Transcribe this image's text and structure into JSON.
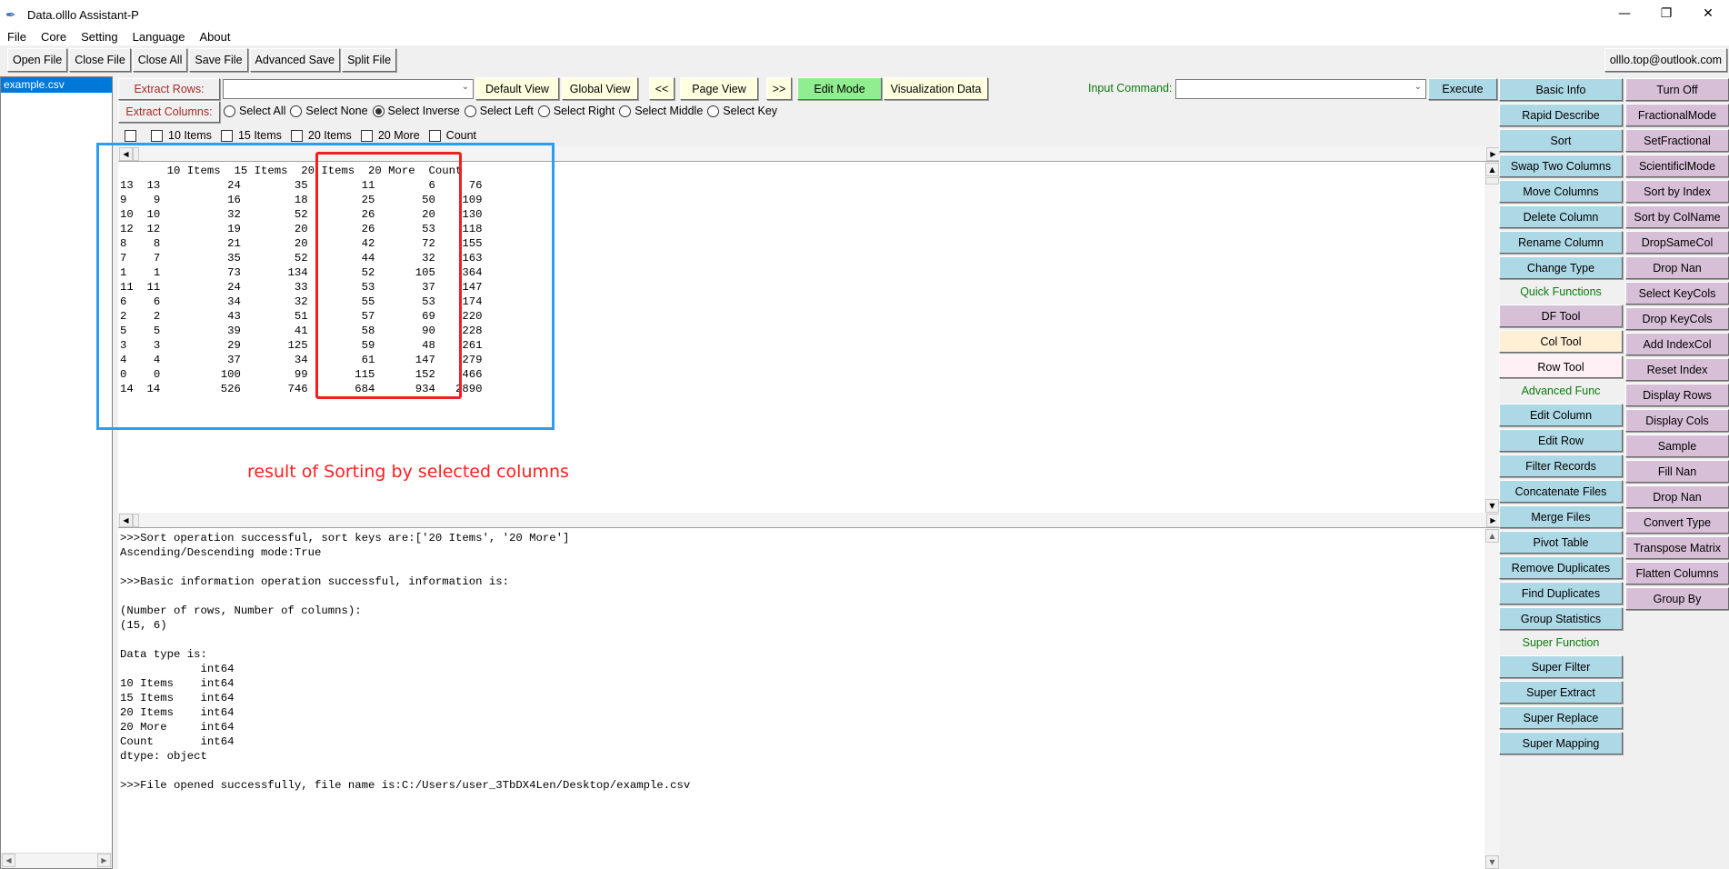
{
  "window": {
    "title": "Data.olllo Assistant-P",
    "controls": [
      "minimize-icon",
      "restore-icon",
      "close-icon"
    ]
  },
  "menu": [
    "File",
    "Core",
    "Setting",
    "Language",
    "About"
  ],
  "toolbar": [
    "Open File",
    "Close File",
    "Close All",
    "Save File",
    "Advanced Save",
    "Split File"
  ],
  "email": "olllo.top@outlook.com",
  "files": [
    "example.csv"
  ],
  "extract_rows_label": "Extract Rows:",
  "extract_rows_value": "",
  "extract_columns_label": "Extract Columns:",
  "view_buttons": [
    "Default View",
    "Global View",
    "<<",
    "Page View",
    ">>",
    "Edit Mode",
    "Visualization Data"
  ],
  "radio_options": [
    {
      "label": "Select All",
      "checked": false
    },
    {
      "label": "Select None",
      "checked": false
    },
    {
      "label": "Select Inverse",
      "checked": true
    },
    {
      "label": "Select Left",
      "checked": false
    },
    {
      "label": "Select Right",
      "checked": false
    },
    {
      "label": "Select Middle",
      "checked": false
    },
    {
      "label": "Select Key",
      "checked": false
    }
  ],
  "column_checks": [
    "",
    "10 Items",
    "15 Items",
    "20 Items",
    "20 More",
    "Count"
  ],
  "input_command": {
    "label": "Input Command:",
    "value": "",
    "execute": "Execute"
  },
  "table": {
    "columns": [
      "",
      "10 Items",
      "15 Items",
      "20 Items",
      "20 More",
      "Count"
    ],
    "rows": [
      [
        "13",
        "13",
        "24",
        "35",
        "11",
        "6",
        "76"
      ],
      [
        "9",
        "9",
        "16",
        "18",
        "25",
        "50",
        "109"
      ],
      [
        "10",
        "10",
        "32",
        "52",
        "26",
        "20",
        "130"
      ],
      [
        "12",
        "12",
        "19",
        "20",
        "26",
        "53",
        "118"
      ],
      [
        "8",
        "8",
        "21",
        "20",
        "42",
        "72",
        "155"
      ],
      [
        "7",
        "7",
        "35",
        "52",
        "44",
        "32",
        "163"
      ],
      [
        "1",
        "1",
        "73",
        "134",
        "52",
        "105",
        "364"
      ],
      [
        "11",
        "11",
        "24",
        "33",
        "53",
        "37",
        "147"
      ],
      [
        "6",
        "6",
        "34",
        "32",
        "55",
        "53",
        "174"
      ],
      [
        "2",
        "2",
        "43",
        "51",
        "57",
        "69",
        "220"
      ],
      [
        "5",
        "5",
        "39",
        "41",
        "58",
        "90",
        "228"
      ],
      [
        "3",
        "3",
        "29",
        "125",
        "59",
        "48",
        "261"
      ],
      [
        "4",
        "4",
        "37",
        "34",
        "61",
        "147",
        "279"
      ],
      [
        "0",
        "0",
        "100",
        "99",
        "115",
        "152",
        "466"
      ],
      [
        "14",
        "14",
        "526",
        "746",
        "684",
        "934",
        "2890"
      ]
    ]
  },
  "annotation": "result of Sorting by selected columns",
  "log_lines": [
    ">>>Sort operation successful, sort keys are:['20 Items', '20 More']",
    "Ascending/Descending mode:True",
    "",
    ">>>Basic information operation successful, information is:",
    "",
    "(Number of rows, Number of columns):",
    "(15, 6)",
    "",
    "Data type is:",
    "            int64",
    "10 Items    int64",
    "15 Items    int64",
    "20 Items    int64",
    "20 More     int64",
    "Count       int64",
    "dtype: object",
    "",
    ">>>File opened successfully, file name is:C:/Users/user_3TbDX4Len/Desktop/example.csv"
  ],
  "right_panel_col1": [
    {
      "type": "button",
      "label": "Basic Info",
      "color": "#add8e6"
    },
    {
      "type": "button",
      "label": "Rapid Describe",
      "color": "#add8e6"
    },
    {
      "type": "button",
      "label": "Sort",
      "color": "#add8e6"
    },
    {
      "type": "button",
      "label": "Swap Two Columns",
      "color": "#add8e6"
    },
    {
      "type": "button",
      "label": "Move Columns",
      "color": "#add8e6"
    },
    {
      "type": "button",
      "label": "Delete Column",
      "color": "#add8e6"
    },
    {
      "type": "button",
      "label": "Rename Column",
      "color": "#add8e6"
    },
    {
      "type": "button",
      "label": "Change Type",
      "color": "#add8e6"
    },
    {
      "type": "label",
      "label": "Quick Functions"
    },
    {
      "type": "button",
      "label": "DF Tool",
      "color": "#d8bfd8"
    },
    {
      "type": "button",
      "label": "Col Tool",
      "color": "#ffefd5"
    },
    {
      "type": "button",
      "label": "Row Tool",
      "color": "#fff0f5"
    },
    {
      "type": "label",
      "label": "Advanced Func"
    },
    {
      "type": "button",
      "label": "Edit Column",
      "color": "#add8e6"
    },
    {
      "type": "button",
      "label": "Edit Row",
      "color": "#add8e6"
    },
    {
      "type": "button",
      "label": "Filter Records",
      "color": "#add8e6"
    },
    {
      "type": "button",
      "label": "Concatenate Files",
      "color": "#add8e6"
    },
    {
      "type": "button",
      "label": "Merge Files",
      "color": "#add8e6"
    },
    {
      "type": "button",
      "label": "Pivot Table",
      "color": "#add8e6"
    },
    {
      "type": "button",
      "label": "Remove Duplicates",
      "color": "#add8e6"
    },
    {
      "type": "button",
      "label": "Find Duplicates",
      "color": "#add8e6"
    },
    {
      "type": "button",
      "label": "Group Statistics",
      "color": "#add8e6"
    },
    {
      "type": "label",
      "label": "Super Function"
    },
    {
      "type": "button",
      "label": "Super Filter",
      "color": "#add8e6"
    },
    {
      "type": "button",
      "label": "Super Extract",
      "color": "#add8e6"
    },
    {
      "type": "button",
      "label": "Super Replace",
      "color": "#add8e6"
    },
    {
      "type": "button",
      "label": "Super Mapping",
      "color": "#add8e6"
    }
  ],
  "right_panel_col2": [
    "Turn Off",
    "FractionalMode",
    "SetFractional",
    "ScientificlMode",
    "Sort by Index",
    "Sort by ColName",
    "DropSameCol",
    "Drop Nan",
    "Select KeyCols",
    "Drop KeyCols",
    "Add IndexCol",
    "Reset Index",
    "Display Rows",
    "Display Cols",
    "Sample",
    "Fill Nan",
    "Drop Nan",
    "Convert Type",
    "Transpose Matrix",
    "Flatten Columns",
    "Group By"
  ]
}
